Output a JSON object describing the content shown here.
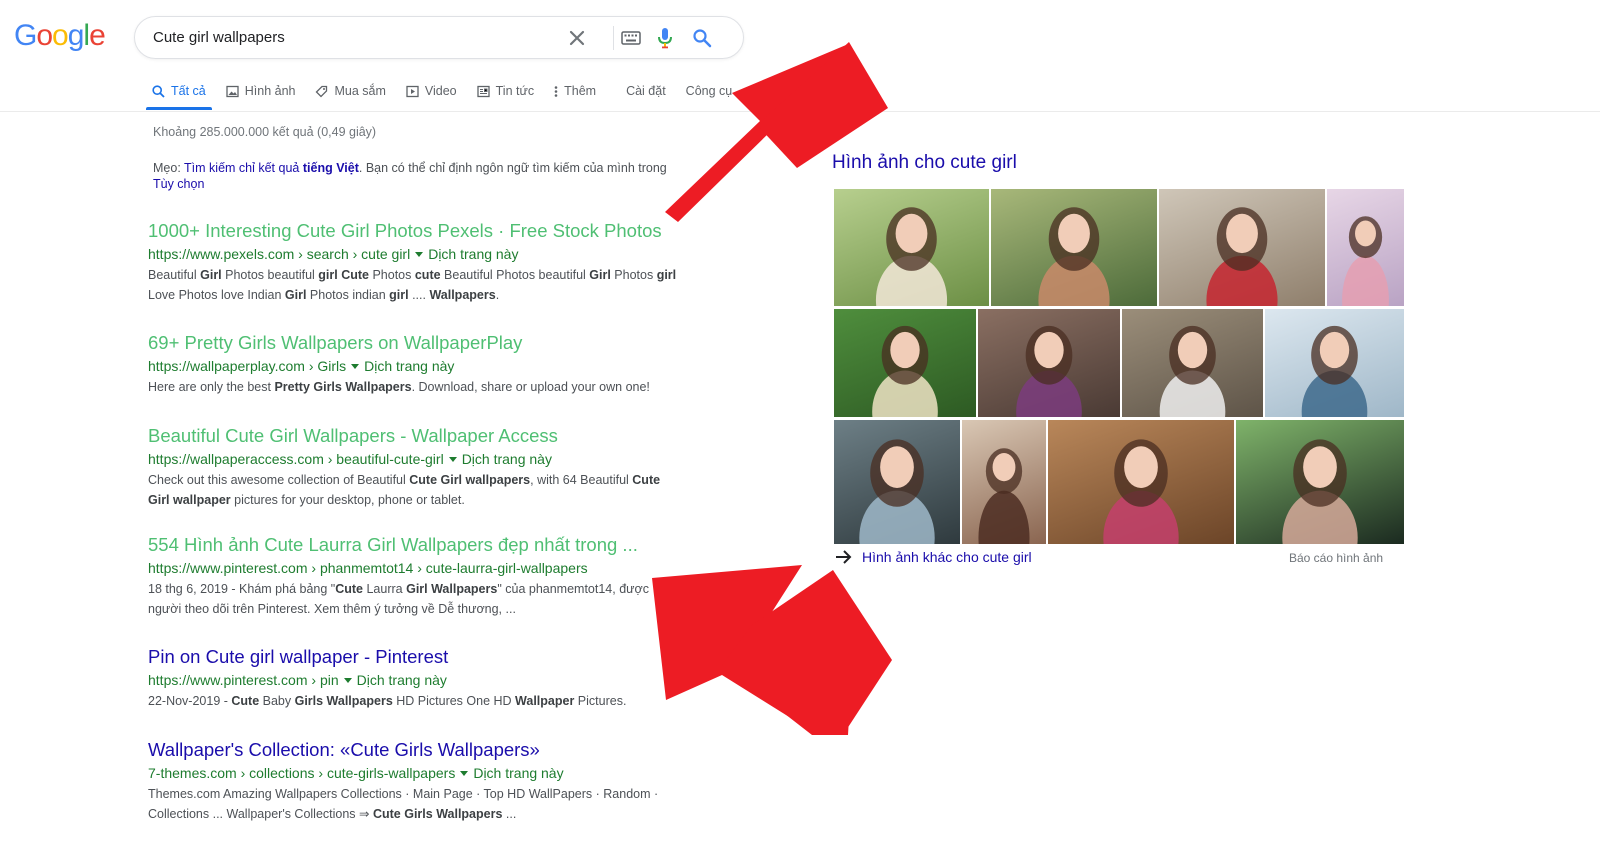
{
  "logo": {
    "text": "Google",
    "letters": [
      "G",
      "o",
      "o",
      "g",
      "l",
      "e"
    ],
    "colors": [
      "#4285f4",
      "#ea4335",
      "#fbbc05",
      "#4285f4",
      "#34a853",
      "#ea4335"
    ]
  },
  "search": {
    "value": "Cute girl wallpapers",
    "icons": [
      "close-icon",
      "keyboard-icon",
      "microphone-icon",
      "search-icon"
    ]
  },
  "tabs": [
    {
      "label": "Tất cả",
      "icon": "search-icon",
      "active": true
    },
    {
      "label": "Hình ảnh",
      "icon": "image-icon"
    },
    {
      "label": "Mua sắm",
      "icon": "tag-icon"
    },
    {
      "label": "Video",
      "icon": "video-icon"
    },
    {
      "label": "Tin tức",
      "icon": "news-icon"
    },
    {
      "label": "Thêm",
      "icon": "more-vert-icon"
    },
    {
      "label": "Cài đặt"
    },
    {
      "label": "Công cụ"
    }
  ],
  "stats": "Khoảng 285.000.000 kết quả (0,49 giây)",
  "tip": {
    "prefix": "Mẹo: ",
    "link1": "Tìm kiếm chỉ kết quả",
    "lang": "tiếng Việt",
    "middle": ". Bạn có thể chỉ định ngôn ngữ tìm kiếm của mình trong",
    "link2": "Tùy chọn"
  },
  "results": [
    {
      "title": "1000+ Interesting Cute Girl Photos Pexels · Free Stock Photos",
      "url": "https://www.pexels.com › search › cute girl",
      "translate": "Dịch trang này",
      "snippet_html": "Beautiful <b>Girl</b> Photos beautiful <b>girl Cute</b> Photos <b>cute</b> Beautiful Photos beautiful <b>Girl</b> Photos <b>girl</b><br>Love Photos love Indian <b>Girl</b> Photos indian <b>girl</b> .... <b>Wallpapers</b>."
    },
    {
      "title": "69+ Pretty Girls Wallpapers on WallpaperPlay",
      "url": "https://wallpaperplay.com › Girls",
      "translate": "Dịch trang này",
      "snippet_html": "Here are only the best <b>Pretty Girls Wallpapers</b>. Download, share or upload your own one!"
    },
    {
      "title": "Beautiful Cute Girl Wallpapers - Wallpaper Access",
      "url": "https://wallpaperaccess.com › beautiful-cute-girl",
      "translate": "Dịch trang này",
      "snippet_html": "Check out this awesome collection of Beautiful <b>Cute Girl wallpapers</b>, with 64 Beautiful <b>Cute</b><br><b>Girl wallpaper</b> pictures for your desktop, phone or tablet."
    },
    {
      "title": "554 Hình ảnh Cute Laurra Girl Wallpapers đẹp nhất trong ...",
      "url": "https://www.pinterest.com › phanmemtot14 › cute-laurra-girl-wallpapers",
      "translate": "",
      "snippet_html": "18 thg 6, 2019 - Khám phá bảng \"<b>Cute</b> Laurra <b>Girl Wallpapers</b>\" của phanmemtot14, được<br>người theo dõi trên Pinterest. Xem thêm ý tưởng về Dễ thương, ..."
    },
    {
      "title": "Pin on Cute girl wallpaper - Pinterest",
      "url": "https://www.pinterest.com › pin",
      "translate": "Dịch trang này",
      "snippet_html": "22-Nov-2019 - <b>Cute</b> Baby <b>Girls Wallpapers</b> HD Pictures One HD <b>Wallpaper</b> Pictures."
    },
    {
      "title": "Wallpaper's Collection: «Cute Girls Wallpapers»",
      "url": "7-themes.com › collections › cute-girls-wallpapers",
      "translate": "Dịch trang này",
      "snippet_html": "Themes.com Amazing Wallpapers Collections · Main Page · Top HD WallPapers · Random ·<br>Collections ... Wallpaper's Collections ⇒ <b>Cute Girls Wallpapers</b> ..."
    }
  ],
  "images_panel": {
    "title": "Hình ảnh cho cute girl",
    "more_link": "Hình ảnh khác cho cute girl",
    "report": "Báo cáo hình ảnh",
    "tiles": [
      {
        "c1": "#b7cf8e",
        "c2": "#6c8f45",
        "accent": "#f3e7d8"
      },
      {
        "c1": "#a8b87a",
        "c2": "#4d6b3a",
        "accent": "#c98a6a"
      },
      {
        "c1": "#cfc6b8",
        "c2": "#8f7f6c",
        "accent": "#c62630"
      },
      {
        "c1": "#e7d6e6",
        "c2": "#b9a3c4",
        "accent": "#e59fb2"
      },
      {
        "c1": "#4f8e3d",
        "c2": "#2d5a23",
        "accent": "#efe3c4"
      },
      {
        "c1": "#8a6f62",
        "c2": "#4a3a34",
        "accent": "#7b3c7e"
      },
      {
        "c1": "#9b8e7a",
        "c2": "#5e5448",
        "accent": "#efefef"
      },
      {
        "c1": "#dce7ef",
        "c2": "#9fb7c8",
        "accent": "#3e6a8c"
      },
      {
        "c1": "#6d7f86",
        "c2": "#2f3a3e",
        "accent": "#9fb9c9"
      },
      {
        "c1": "#d9c7b4",
        "c2": "#8a6550",
        "accent": "#4c2d22"
      },
      {
        "c1": "#b9875a",
        "c2": "#6c4528",
        "accent": "#c43f6c"
      },
      {
        "c1": "#7fb36a",
        "c2": "#1b2a20",
        "accent": "#d6a99a"
      }
    ]
  },
  "annotations": {
    "arrow_color": "#ed1c24"
  }
}
